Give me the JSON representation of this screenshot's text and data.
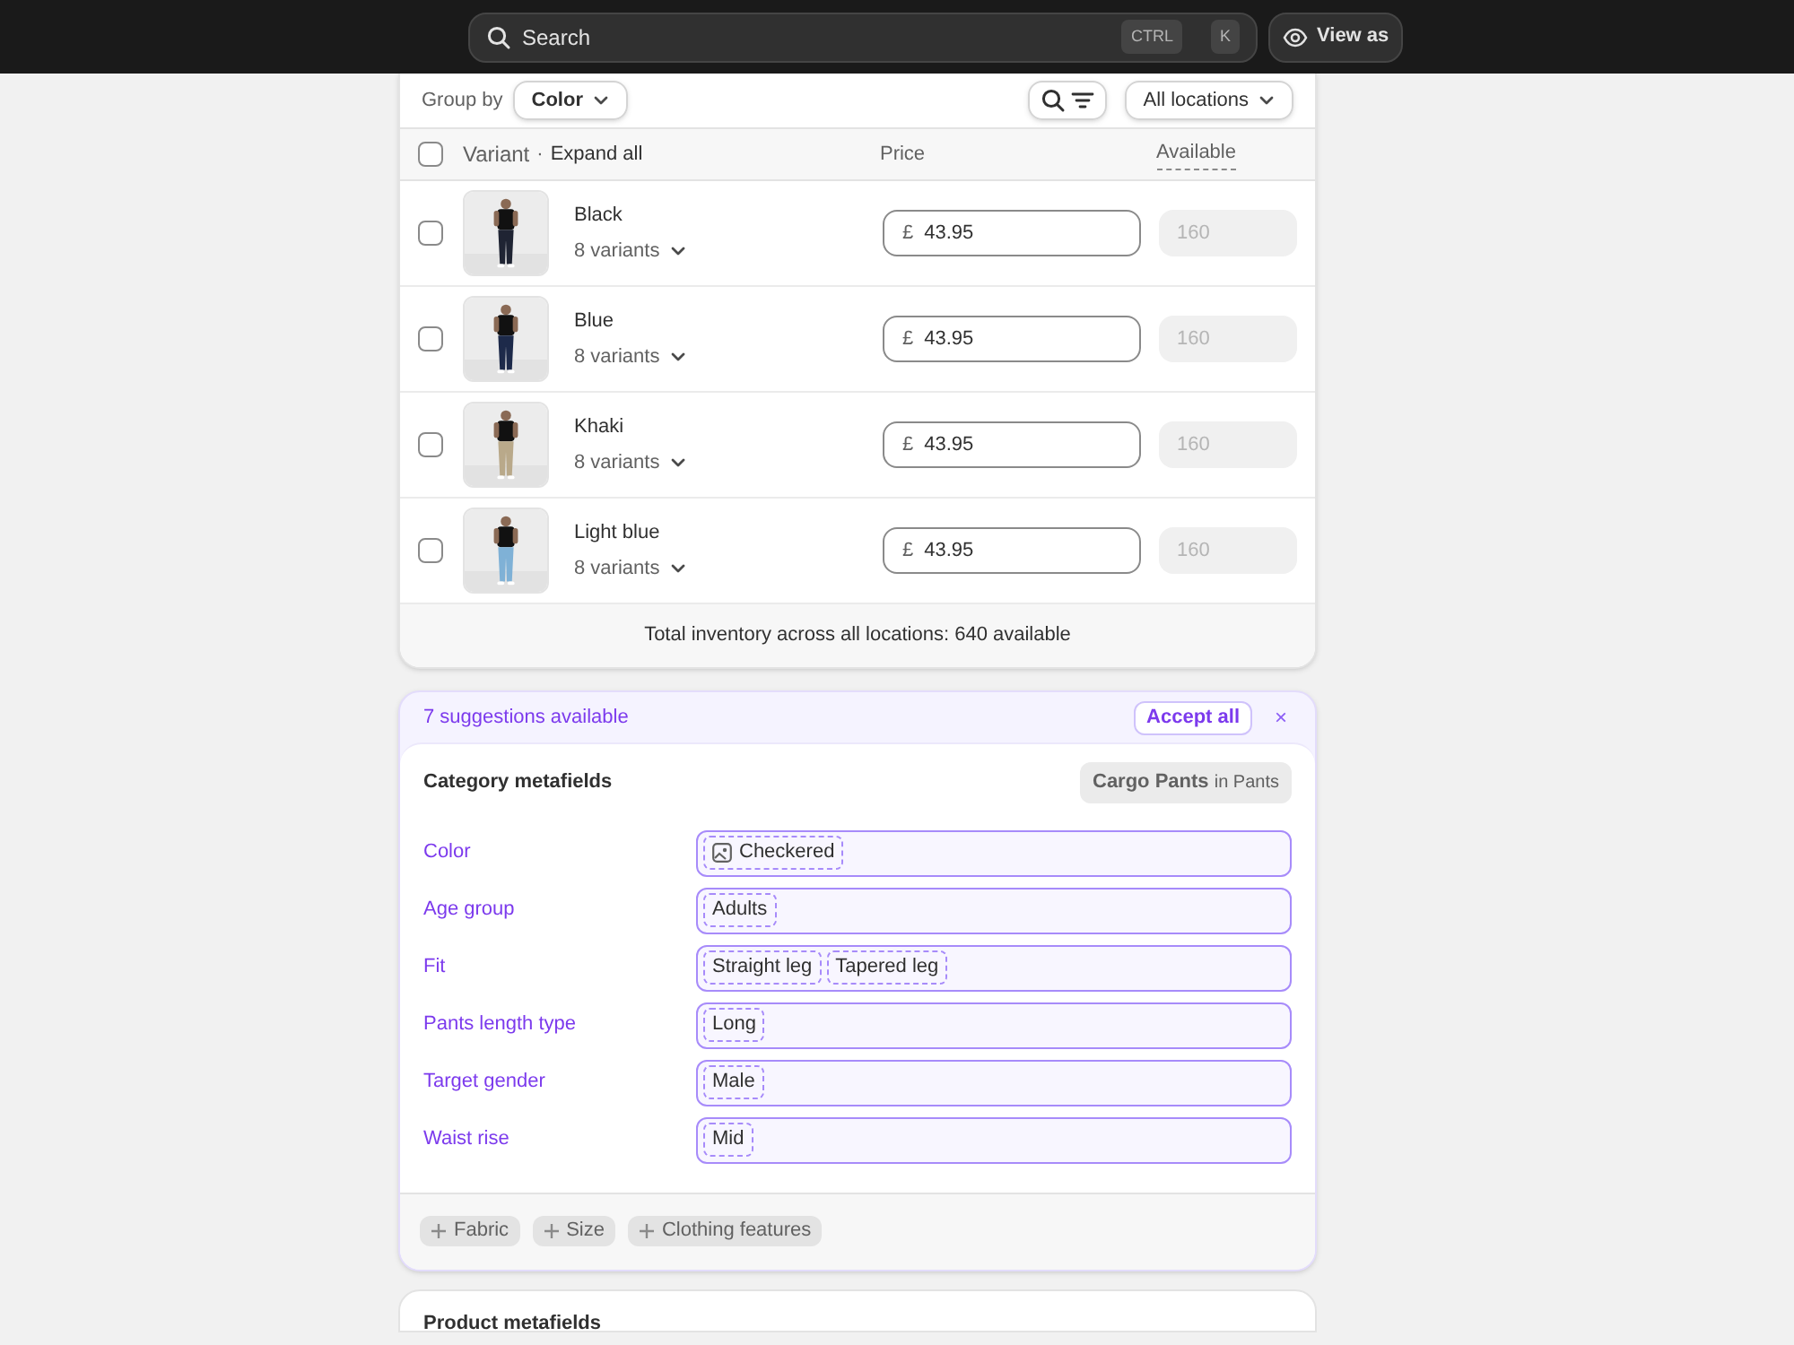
{
  "top_bar": {
    "search": {
      "placeholder": "Search",
      "shortcut": [
        "CTRL",
        "K"
      ]
    },
    "view_as": "View as"
  },
  "variants": {
    "group_by_label": "Group by",
    "group_by": "Color",
    "location": "All locations",
    "select_all_checked": false,
    "columns": {
      "variant": "Variant",
      "separator": "·",
      "expand_all": "Expand all",
      "price": "Price",
      "available": "Available"
    },
    "rows": [
      {
        "name": "Black",
        "variants": "8 variants",
        "currency": "£",
        "price": "43.95",
        "available": "160",
        "checked": false
      },
      {
        "name": "Blue",
        "variants": "8 variants",
        "currency": "£",
        "price": "43.95",
        "available": "160",
        "checked": false
      },
      {
        "name": "Khaki",
        "variants": "8 variants",
        "currency": "£",
        "price": "43.95",
        "available": "160",
        "checked": false
      },
      {
        "name": "Light blue",
        "variants": "8 variants",
        "currency": "£",
        "price": "43.95",
        "available": "160",
        "checked": false
      }
    ],
    "total": "Total inventory across all locations: 640 available"
  },
  "suggestions": {
    "banner": "7 suggestions available",
    "accept_all": "Accept all",
    "close": "×",
    "title": "Category metafields",
    "category": "Cargo Pants",
    "category_parent": "in Pants",
    "fields": [
      {
        "label": "Color",
        "values": [
          {
            "text": "Checkered",
            "swatch": true
          }
        ]
      },
      {
        "label": "Age group",
        "values": [
          {
            "text": "Adults",
            "swatch": false
          }
        ]
      },
      {
        "label": "Fit",
        "values": [
          {
            "text": "Straight leg",
            "swatch": false
          },
          {
            "text": "Tapered leg",
            "swatch": false
          }
        ]
      },
      {
        "label": "Pants length type",
        "values": [
          {
            "text": "Long",
            "swatch": false
          }
        ]
      },
      {
        "label": "Target gender",
        "values": [
          {
            "text": "Male",
            "swatch": false
          }
        ]
      },
      {
        "label": "Waist rise",
        "values": [
          {
            "text": "Mid",
            "swatch": false
          }
        ]
      }
    ],
    "add_buttons": [
      "Fabric",
      "Size",
      "Clothing features"
    ]
  },
  "next_card": {
    "title": "Product metafields"
  }
}
